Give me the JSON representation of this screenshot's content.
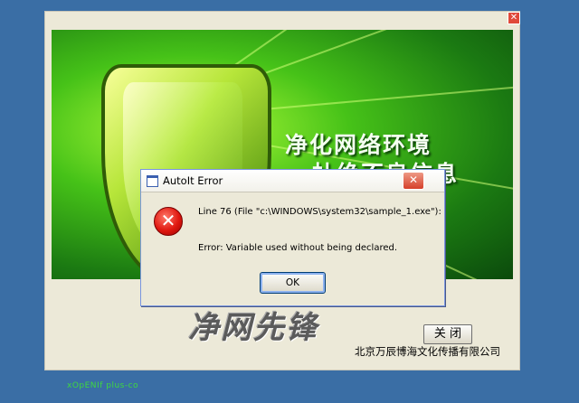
{
  "splash": {
    "close_glyph": "✕",
    "slogan_line1": "净化网络环境",
    "slogan_line2": "杜绝不良信息",
    "brand_logo_text": "净网先锋",
    "close_button_label": "关 闭",
    "company": "北京万辰博海文化传播有限公司"
  },
  "watermark": "xOpENIf plus-co",
  "dialog": {
    "title": "AutoIt Error",
    "close_glyph": "✕",
    "error_icon_glyph": "✕",
    "line1": "Line 76  (File \"c:\\WINDOWS\\system32\\sample_1.exe\"):",
    "line2": "Error: Variable used without being declared.",
    "ok_label": "OK"
  }
}
